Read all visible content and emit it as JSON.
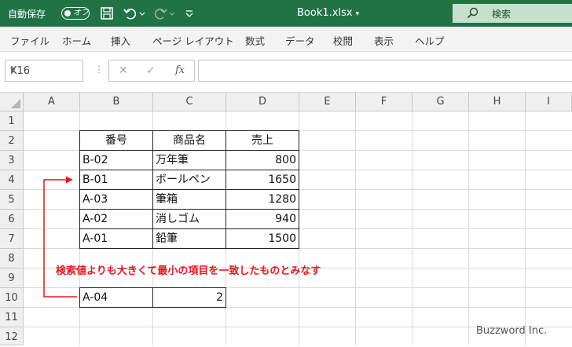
{
  "titlebar": {
    "autosave_label": "自動保存",
    "toggle_state": "オフ",
    "filename": "Book1.xlsx",
    "search_label": "検索"
  },
  "ribbon": {
    "tabs": [
      "ファイル",
      "ホーム",
      "挿入",
      "ページ レイアウト",
      "数式",
      "データ",
      "校閲",
      "表示",
      "ヘルプ"
    ]
  },
  "formula_bar": {
    "name_box": "K16",
    "fx_label": "fx",
    "formula": ""
  },
  "columns": [
    "A",
    "B",
    "C",
    "D",
    "E",
    "F",
    "G",
    "H",
    "I"
  ],
  "rows": [
    "1",
    "2",
    "3",
    "4",
    "5",
    "6",
    "7",
    "8",
    "9",
    "10",
    "11",
    "12"
  ],
  "table": {
    "headers": [
      "番号",
      "商品名",
      "売上"
    ],
    "rows": [
      [
        "B-02",
        "万年筆",
        "800"
      ],
      [
        "B-01",
        "ボールペン",
        "1650"
      ],
      [
        "A-03",
        "筆箱",
        "1280"
      ],
      [
        "A-02",
        "消しゴム",
        "940"
      ],
      [
        "A-01",
        "鉛筆",
        "1500"
      ]
    ]
  },
  "lookup": {
    "key": "A-04",
    "result": "2"
  },
  "annotation": "検索値よりも大きくて最小の項目を一致したものとみなす",
  "watermark": "Buzzword Inc.",
  "colors": {
    "title_bar": "#217346",
    "annotation_red": "#e0191e"
  }
}
